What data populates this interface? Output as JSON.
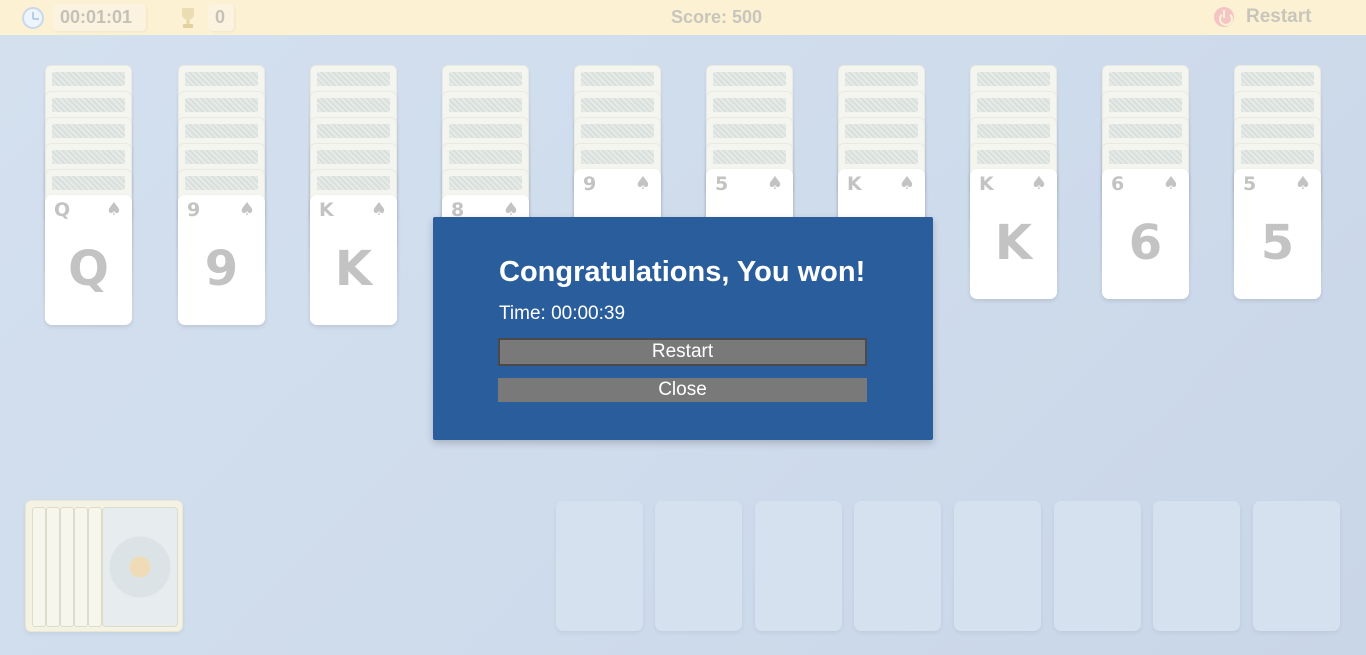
{
  "topbar": {
    "elapsed_time": "00:01:01",
    "wins": "0",
    "score": "Score: 500",
    "restart_label": "Restart"
  },
  "tableau": [
    {
      "backs": 5,
      "face": {
        "rank": "Q",
        "suit": "♠"
      }
    },
    {
      "backs": 5,
      "face": {
        "rank": "9",
        "suit": "♠"
      }
    },
    {
      "backs": 5,
      "face": {
        "rank": "K",
        "suit": "♠"
      }
    },
    {
      "backs": 5,
      "face": {
        "rank": "8",
        "suit": "♠"
      }
    },
    {
      "backs": 4,
      "face": {
        "rank": "9",
        "suit": "♠"
      }
    },
    {
      "backs": 4,
      "face": {
        "rank": "5",
        "suit": "♠"
      }
    },
    {
      "backs": 4,
      "face": {
        "rank": "K",
        "suit": "♠"
      }
    },
    {
      "backs": 4,
      "face": {
        "rank": "K",
        "suit": "♠"
      }
    },
    {
      "backs": 4,
      "face": {
        "rank": "6",
        "suit": "♠"
      }
    },
    {
      "backs": 4,
      "face": {
        "rank": "5",
        "suit": "♠"
      }
    }
  ],
  "stock": {
    "visible_edges": 5
  },
  "foundations": {
    "count": 8
  },
  "dialog": {
    "title": "Congratulations, You won!",
    "time": "Time: 00:00:39",
    "restart_label": "Restart",
    "close_label": "Close"
  },
  "colors": {
    "topbar": "#fcf1d2",
    "dialog_bg": "#2a5d9c",
    "dialog_button": "#797979",
    "card_rank": "#c3c3c3"
  }
}
